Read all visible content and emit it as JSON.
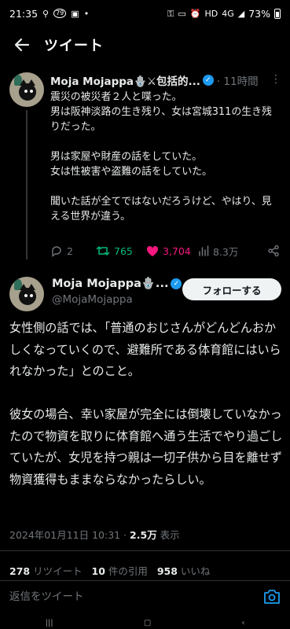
{
  "status_bar": {
    "time": "21:35",
    "badge": "79",
    "network": "4G",
    "battery": "73%"
  },
  "header": {
    "title": "ツイート"
  },
  "tweet1": {
    "name": "Moja Mojappa🪬⚔包括的...",
    "time": "· 11時間",
    "body": "震災の被災者２人と喋った。\n男は阪神淡路の生き残り、女は宮城311の生き残りだった。\n\n男は家屋や財産の話をしていた。\n女は性被害や盗難の話をしていた。\n\n聞いた話が全てではないだろうけど、やはり、見える世界が違う。",
    "replies": "2",
    "retweets": "765",
    "likes": "3,704",
    "views": "8.3万"
  },
  "tweet2": {
    "name": "Moja Mojappa🪬...",
    "handle": "@MojaMojappa",
    "follow_label": "フォローする",
    "body": "女性側の話では、「普通のおじさんがどんどんおかしくなっていくので、避難所である体育館にはいられなかった」とのこと。\n\n彼女の場合、幸い家屋が完全には倒壊していなかったので物資を取りに体育館へ通う生活でやり過ごしていたが、女児を持つ親は一切子供から目を離せず物資獲得もままならなかったらしい。",
    "timestamp": "2024年01月11日 10:31 · ",
    "view_count": "2.5万",
    "view_label": " 表示",
    "stats": {
      "retweet_count": "278",
      "retweet_label": " リツイート",
      "quote_count": "10",
      "quote_label": " 件の引用",
      "like_count": "958",
      "like_label": " いいね"
    }
  },
  "reply": {
    "placeholder": "返信をツイート"
  },
  "colors": {
    "accent": "#1d9bf0",
    "retweet": "#00ba7c",
    "like": "#f91880",
    "muted": "#71767b"
  }
}
